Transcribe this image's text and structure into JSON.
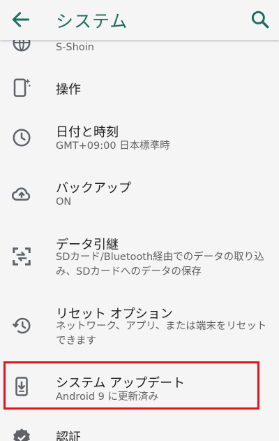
{
  "app_bar": {
    "title": "システム",
    "back_icon": "arrow-back-icon",
    "search_icon": "search-icon"
  },
  "items": [
    {
      "title": "",
      "subtitle": "S-Shoin",
      "icon": "globe-icon"
    },
    {
      "title": "操作",
      "subtitle": "",
      "icon": "gesture-icon"
    },
    {
      "title": "日付と時刻",
      "subtitle": "GMT+09:00 日本標準時",
      "icon": "clock-icon"
    },
    {
      "title": "バックアップ",
      "subtitle": "ON",
      "icon": "cloud-upload-icon"
    },
    {
      "title": "データ引継",
      "subtitle": "SDカード/Bluetooth経由でのデータの取り込み、SDカードへのデータの保存",
      "icon": "data-transfer-icon"
    },
    {
      "title": "リセット オプション",
      "subtitle": "ネットワーク、アプリ、または端末をリセットできます",
      "icon": "history-icon"
    },
    {
      "title": "システム アップデート",
      "subtitle": "Android 9 に更新済み",
      "icon": "system-update-icon"
    },
    {
      "title": "認証",
      "subtitle": "",
      "icon": "verified-badge-icon"
    }
  ],
  "colors": {
    "accent": "#1a6d5f",
    "highlight_border": "#e0141c",
    "icon": "#5f6368"
  }
}
